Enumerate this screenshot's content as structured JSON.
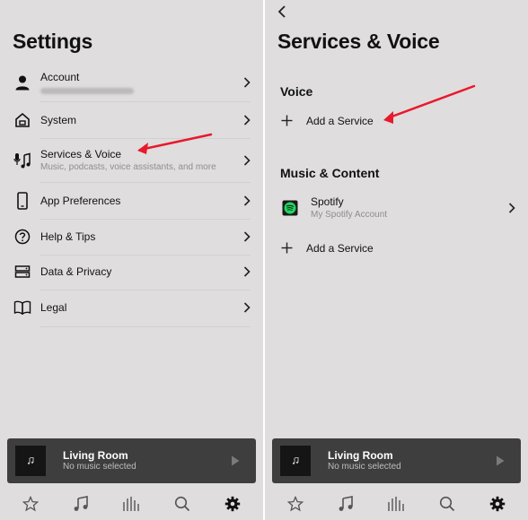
{
  "left": {
    "title": "Settings",
    "items": [
      {
        "label": "Account",
        "icon": "person-icon"
      },
      {
        "label": "System",
        "icon": "home-icon"
      },
      {
        "label": "Services & Voice",
        "sub": "Music, podcasts, voice assistants, and more",
        "icon": "mic-music-icon"
      },
      {
        "label": "App Preferences",
        "icon": "phone-icon"
      },
      {
        "label": "Help & Tips",
        "icon": "help-icon"
      },
      {
        "label": "Data & Privacy",
        "icon": "storage-icon"
      },
      {
        "label": "Legal",
        "icon": "book-icon"
      }
    ]
  },
  "right": {
    "title": "Services & Voice",
    "voice_section": "Voice",
    "voice_add": "Add a Service",
    "music_section": "Music & Content",
    "service": {
      "name": "Spotify",
      "account": "My Spotify Account",
      "icon": "spotify-icon"
    },
    "music_add": "Add a Service"
  },
  "player": {
    "room": "Living Room",
    "status": "No music selected"
  },
  "tabs": [
    "favorites-icon",
    "music-icon",
    "rooms-icon",
    "search-icon",
    "settings-icon"
  ],
  "colors": {
    "panel_bg": "#dfdddd",
    "player_bg": "#3e3e3e",
    "annotation_arrow": "#e8192c",
    "spotify_green": "#1ed760"
  }
}
